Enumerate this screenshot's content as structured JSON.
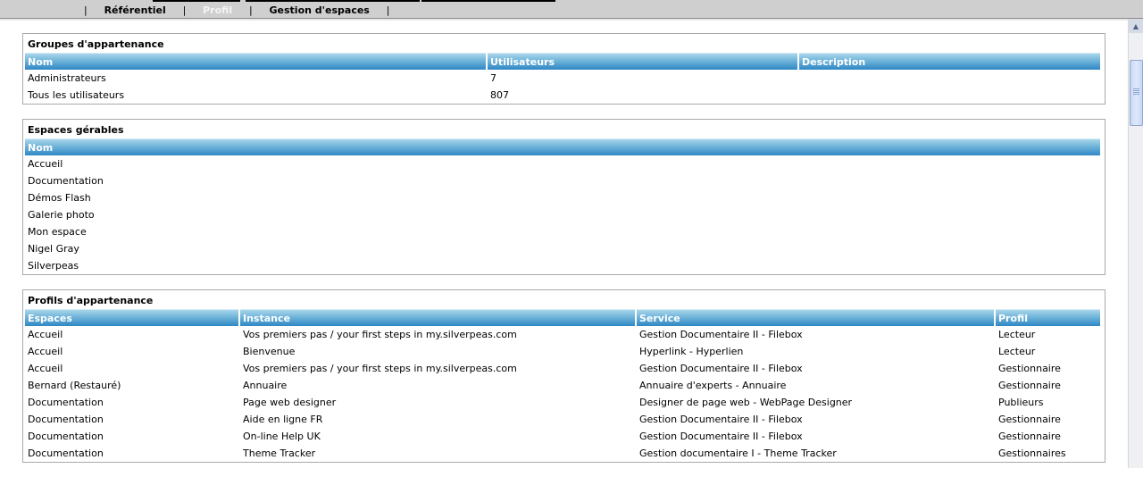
{
  "topbar": {
    "tabs": [
      {
        "label": "Référentiel",
        "active": false
      },
      {
        "label": "Profil",
        "active": true
      },
      {
        "label": "Gestion d'espaces",
        "active": false
      }
    ],
    "separator": "|"
  },
  "groups": {
    "title": "Groupes d'appartenance",
    "columns": [
      "Nom",
      "Utilisateurs",
      "Description"
    ],
    "rows": [
      [
        "Administrateurs",
        "7",
        ""
      ],
      [
        "Tous les utilisateurs",
        "807",
        ""
      ]
    ]
  },
  "spaces": {
    "title": "Espaces gérables",
    "columns": [
      "Nom"
    ],
    "rows": [
      "Accueil",
      "Documentation",
      "Démos Flash",
      "Galerie photo",
      "Mon espace",
      "Nigel Gray",
      "Silverpeas"
    ]
  },
  "profiles": {
    "title": "Profils d'appartenance",
    "columns": [
      "Espaces",
      "Instance",
      "Service",
      "Profil"
    ],
    "rows": [
      [
        "Accueil",
        "Vos premiers pas / your first steps in my.silverpeas.com",
        "Gestion Documentaire II - Filebox",
        "Lecteur"
      ],
      [
        "Accueil",
        "Bienvenue",
        "Hyperlink - Hyperlien",
        "Lecteur"
      ],
      [
        "Accueil",
        "Vos premiers pas / your first steps in my.silverpeas.com",
        "Gestion Documentaire II - Filebox",
        "Gestionnaire"
      ],
      [
        "Bernard (Restauré)",
        "Annuaire",
        "Annuaire d'experts - Annuaire",
        "Gestionnaire"
      ],
      [
        "Documentation",
        "Page web designer",
        "Designer de page web - WebPage Designer",
        "Publieurs"
      ],
      [
        "Documentation",
        "Aide en ligne FR",
        "Gestion Documentaire II - Filebox",
        "Gestionnaire"
      ],
      [
        "Documentation",
        "On-line Help UK",
        "Gestion Documentaire II - Filebox",
        "Gestionnaire"
      ],
      [
        "Documentation",
        "Theme Tracker",
        "Gestion documentaire I - Theme Tracker",
        "Gestionnaires"
      ]
    ]
  }
}
